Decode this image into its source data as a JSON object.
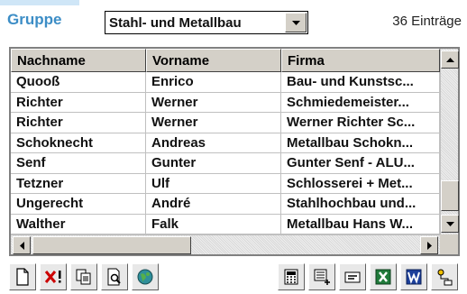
{
  "header": {
    "group_label": "Gruppe",
    "group_selected": "Stahl- und Metallbau",
    "entry_count": "36 Einträge"
  },
  "table": {
    "columns": [
      "Nachname",
      "Vorname",
      "Firma"
    ],
    "rows": [
      [
        "Quooß",
        "Enrico",
        "Bau- und Kunstsc..."
      ],
      [
        "Richter",
        "Werner",
        "Schmiedemeister..."
      ],
      [
        "Richter",
        "Werner",
        "Werner Richter Sc..."
      ],
      [
        "Schoknecht",
        "Andreas",
        "Metallbau Schokn..."
      ],
      [
        "Senf",
        "Gunter",
        "Gunter Senf - ALU..."
      ],
      [
        "Tetzner",
        "Ulf",
        "Schlosserei + Met..."
      ],
      [
        "Ungerecht",
        "André",
        "Stahlhochbau und..."
      ],
      [
        "Walther",
        "Falk",
        "Metallbau Hans W..."
      ]
    ]
  },
  "toolbar": {
    "icons": [
      "new-document-icon",
      "delete-icon",
      "copy-icon",
      "preview-icon",
      "globe-icon",
      "calculator-icon",
      "add-record-icon",
      "card-icon",
      "excel-icon",
      "word-icon",
      "org-chart-icon"
    ]
  },
  "colors": {
    "accent": "#3c8dc6",
    "header_bg": "#d4d0c8",
    "delete_red": "#cc0000",
    "excel_green": "#1f7a3a",
    "word_blue": "#1c3f9a"
  }
}
